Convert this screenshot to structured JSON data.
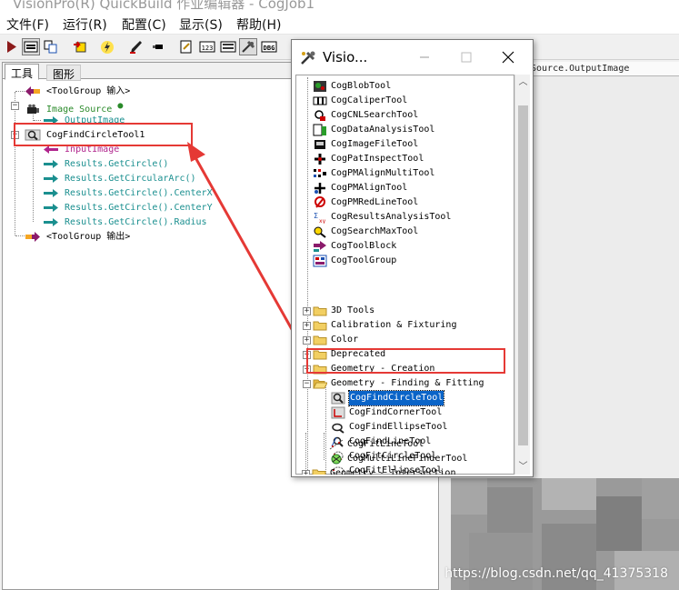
{
  "window": {
    "title": "VisionPro(R) QuickBuild 作业编辑器 - CogJob1"
  },
  "menu": [
    "文件(F)",
    "运行(R)",
    "配置(C)",
    "显示(S)",
    "帮助(H)"
  ],
  "tabs": {
    "tools": "工具",
    "graphics": "图形"
  },
  "tree": [
    {
      "label": "<ToolGroup 输入>",
      "color": "#000000",
      "icon": "tool-input-icon"
    },
    {
      "label": "Image Source",
      "color": "#2a8a2a",
      "icon": "camera-icon"
    },
    {
      "label": "OutputImage",
      "color": "#1a8f8f",
      "icon": "output-arrow-icon"
    },
    {
      "label": "CogFindCircleTool1",
      "color": "#000000",
      "icon": "find-circle-icon"
    },
    {
      "label": "InputImage",
      "color": "#b0248c",
      "icon": "input-arrow-icon"
    },
    {
      "label": "Results.GetCircle()",
      "color": "#1a8f8f",
      "icon": "output-arrow-icon"
    },
    {
      "label": "Results.GetCircularArc()",
      "color": "#1a8f8f",
      "icon": "output-arrow-icon"
    },
    {
      "label": "Results.GetCircle().CenterX",
      "color": "#1a8f8f",
      "icon": "output-arrow-icon"
    },
    {
      "label": "Results.GetCircle().CenterY",
      "color": "#1a8f8f",
      "icon": "output-arrow-icon"
    },
    {
      "label": "Results.GetCircle().Radius",
      "color": "#1a8f8f",
      "icon": "output-arrow-icon"
    },
    {
      "label": "<ToolGroup 输出>",
      "color": "#000000",
      "icon": "tool-output-icon"
    }
  ],
  "image_panel": {
    "header": "Source.OutputImage"
  },
  "popup": {
    "title": "Visio...",
    "tools": [
      "CogBlobTool",
      "CogCaliperTool",
      "CogCNLSearchTool",
      "CogDataAnalysisTool",
      "CogImageFileTool",
      "CogPatInspectTool",
      "CogPMAlignMultiTool",
      "CogPMAlignTool",
      "CogPMRedLineTool",
      "CogResultsAnalysisTool",
      "CogSearchMaxTool",
      "CogToolBlock",
      "CogToolGroup"
    ],
    "folders": [
      "3D Tools",
      "Calibration & Fixturing",
      "Color",
      "Deprecated",
      "Geometry - Creation",
      "Geometry - Finding & Fitting"
    ],
    "finding_tools": [
      "CogFindCircleTool",
      "CogFindCornerTool",
      "CogFindEllipseTool",
      "CogFindLineTool",
      "CogFitCircleTool",
      "CogFitEllipseTool",
      "CogFitLineTool",
      "CogMultiLineFinderTool"
    ],
    "next_folder": "Geometry - Intersection",
    "selected": "CogFindCircleTool"
  },
  "watermark": "https://blog.csdn.net/qq_41375318",
  "colors": {
    "annotation": "#e53935",
    "selection": "#0a64c8"
  }
}
